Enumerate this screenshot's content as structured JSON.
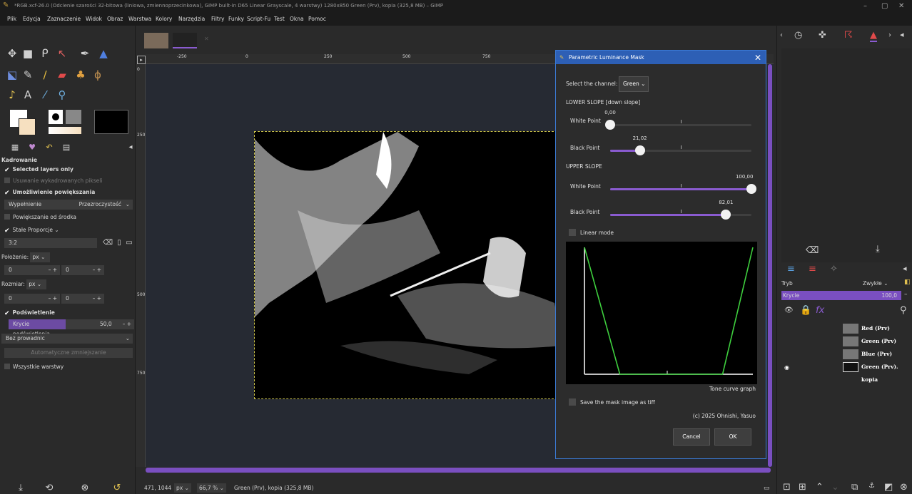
{
  "window": {
    "title": "*RGB.xcf-26.0 (Odcienie szarości 32-bitowa (liniowa, zmiennoprzecinkowa), GIMP built-in D65 Linear Grayscale, 4 warstwy) 1280x850 Green (Prv), kopia (325,8 MB) – GIMP",
    "minimize": "–",
    "maximize": "▢",
    "close": "✕"
  },
  "menu": [
    "Plik",
    "Edycja",
    "Zaznaczenie",
    "Widok",
    "Obraz",
    "Warstwa",
    "Kolory",
    "Narzędzia",
    "Filtry",
    "Funky",
    "Script-Fu",
    "Test",
    "Okna",
    "Pomoc"
  ],
  "tool_options": {
    "title": "Kadrowanie",
    "selected_layers_only": "Selected layers only",
    "delete_cropped": "Usuwanie wykadrowanych pikseli",
    "allow_growing": "Umożliwienie powiększania",
    "fill_label": "Wypełnienie",
    "fill_value": "Przezroczystość",
    "expand_center": "Powiększanie od środka",
    "fixed": "Stałe",
    "fixed_value": "Proporcje",
    "ratio": "3:2",
    "position_label": "Położenie:",
    "position_unit": "px",
    "pos_x": "0",
    "pos_y": "0",
    "size_label": "Rozmiar:",
    "size_unit": "px",
    "size_w": "0",
    "size_h": "0",
    "highlight": "Podświetlenie",
    "highlight_opacity_label": "Krycie podświetlenia",
    "highlight_opacity_value": "50,0",
    "guides": "Bez prowadnic",
    "auto_shrink": "Automatyczne zmniejszanie",
    "all_layers": "Wszystkie warstwy"
  },
  "ruler": {
    "h_labels": [
      "-250",
      "0",
      "250",
      "500",
      "750"
    ],
    "v_labels": [
      "0",
      "250",
      "500",
      "750"
    ]
  },
  "status": {
    "coords": "471, 1044",
    "unit": "px",
    "zoom": "66,7 %",
    "layer_info": "Green (Prv), kopia (325,8 MB)"
  },
  "dialog": {
    "title": "Parametric Luminance Mask",
    "channel_label": "Select the channel:",
    "channel_value": "Green",
    "lower_slope": "LOWER SLOPE [down slope]",
    "upper_slope": "UPPER SLOPE",
    "white_point": "White Point",
    "black_point": "Black Point",
    "lower_white": "0,00",
    "lower_black": "21,02",
    "upper_white": "100,00",
    "upper_black": "82,01",
    "lower_white_frac": 0.0,
    "lower_black_frac": 0.2102,
    "upper_white_frac": 1.0,
    "upper_black_frac": 0.8201,
    "linear_mode": "Linear mode",
    "graph_caption": "Tone curve graph",
    "save_mask": "Save the mask image as tiff",
    "copyright": "(c) 2025 Ohnishi, Yasuo",
    "cancel": "Cancel",
    "ok": "OK"
  },
  "layers": {
    "mode_label": "Tryb",
    "mode_value": "Zwykłe",
    "opacity_label": "Krycie",
    "opacity_value": "100,0",
    "items": [
      {
        "name": "Red (Prv)",
        "visible": false
      },
      {
        "name": "Green (Prv)",
        "visible": false
      },
      {
        "name": "Blue (Prv)",
        "visible": false
      },
      {
        "name": "Green (Prv). kopia",
        "visible": true
      }
    ]
  },
  "colors": {
    "accent": "#8a5bd0",
    "dialog_title": "#2d5fb5",
    "curve": "#3ecf3e"
  }
}
